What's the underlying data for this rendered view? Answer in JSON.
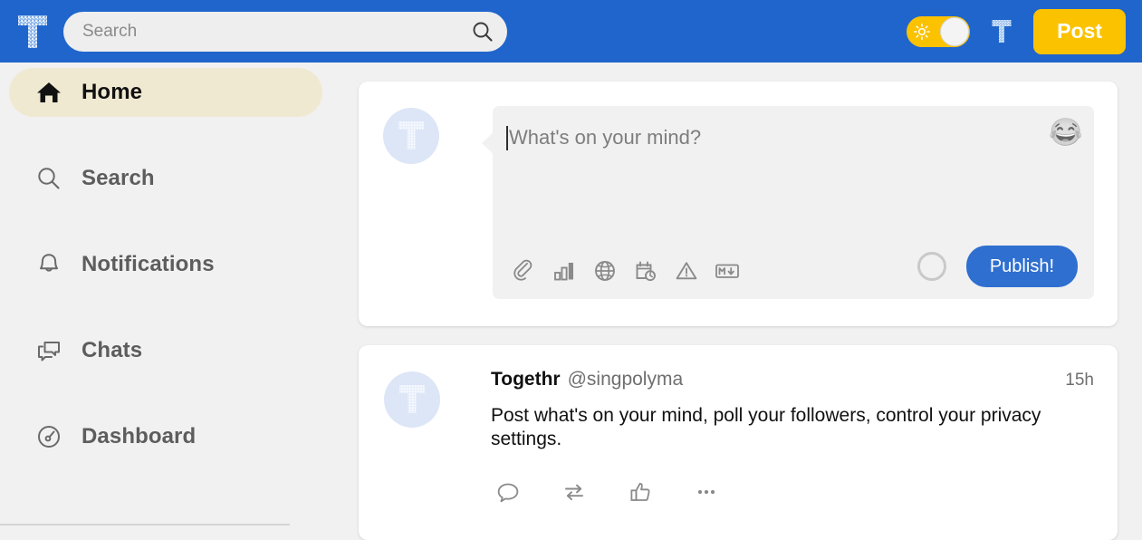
{
  "app": {
    "brand_logo_letter": "T",
    "brand_name": "Togethr"
  },
  "header": {
    "logo_icon": "togethr-t-logo-icon",
    "search": {
      "placeholder": "Search",
      "value": "",
      "icon": "search-icon"
    },
    "theme_toggle": {
      "icon": "sun-icon",
      "state": "light",
      "knob_color": "#f4f4f4",
      "track_color": "#fbc200"
    },
    "account_avatar_icon": "togethr-t-avatar-icon",
    "post_button_label": "Post",
    "colors": {
      "header_background": "#2065cc",
      "accent_yellow": "#fbc200"
    }
  },
  "sidebar": {
    "items": [
      {
        "label": "Home",
        "icon": "home-icon",
        "active": true
      },
      {
        "label": "Search",
        "icon": "search-icon",
        "active": false
      },
      {
        "label": "Notifications",
        "icon": "bell-icon",
        "active": false
      },
      {
        "label": "Chats",
        "icon": "chat-icon",
        "active": false
      },
      {
        "label": "Dashboard",
        "icon": "dashboard-icon",
        "active": false
      }
    ],
    "active_pill_color": "#f0e9d2",
    "background_color": "#f1f1f1"
  },
  "compose": {
    "avatar_letter": "T",
    "placeholder": "What's on your mind?",
    "value": "",
    "emoji_button": "😂",
    "tools": [
      {
        "name": "attach-file-icon",
        "title": "Attach file"
      },
      {
        "name": "poll-icon",
        "title": "Poll"
      },
      {
        "name": "globe-icon",
        "title": "Privacy"
      },
      {
        "name": "schedule-icon",
        "title": "Schedule"
      },
      {
        "name": "content-warning-icon",
        "title": "Content warning"
      },
      {
        "name": "markdown-icon",
        "title": "Markdown"
      }
    ],
    "char_counter_ring": "0",
    "publish_button_label": "Publish!",
    "publish_button_color": "#2f6fd0",
    "box_background": "#f1f1f1"
  },
  "posts": [
    {
      "avatar_letter": "T",
      "author": "Togethr",
      "handle": "@singpolyma",
      "timestamp": "15h",
      "text": "Post what's on your mind, poll your followers, control your privacy settings.",
      "actions": [
        {
          "name": "reply-icon",
          "label": "Reply"
        },
        {
          "name": "repost-icon",
          "label": "Repost"
        },
        {
          "name": "like-icon",
          "label": "Like"
        },
        {
          "name": "more-icon",
          "label": "More"
        }
      ]
    }
  ]
}
